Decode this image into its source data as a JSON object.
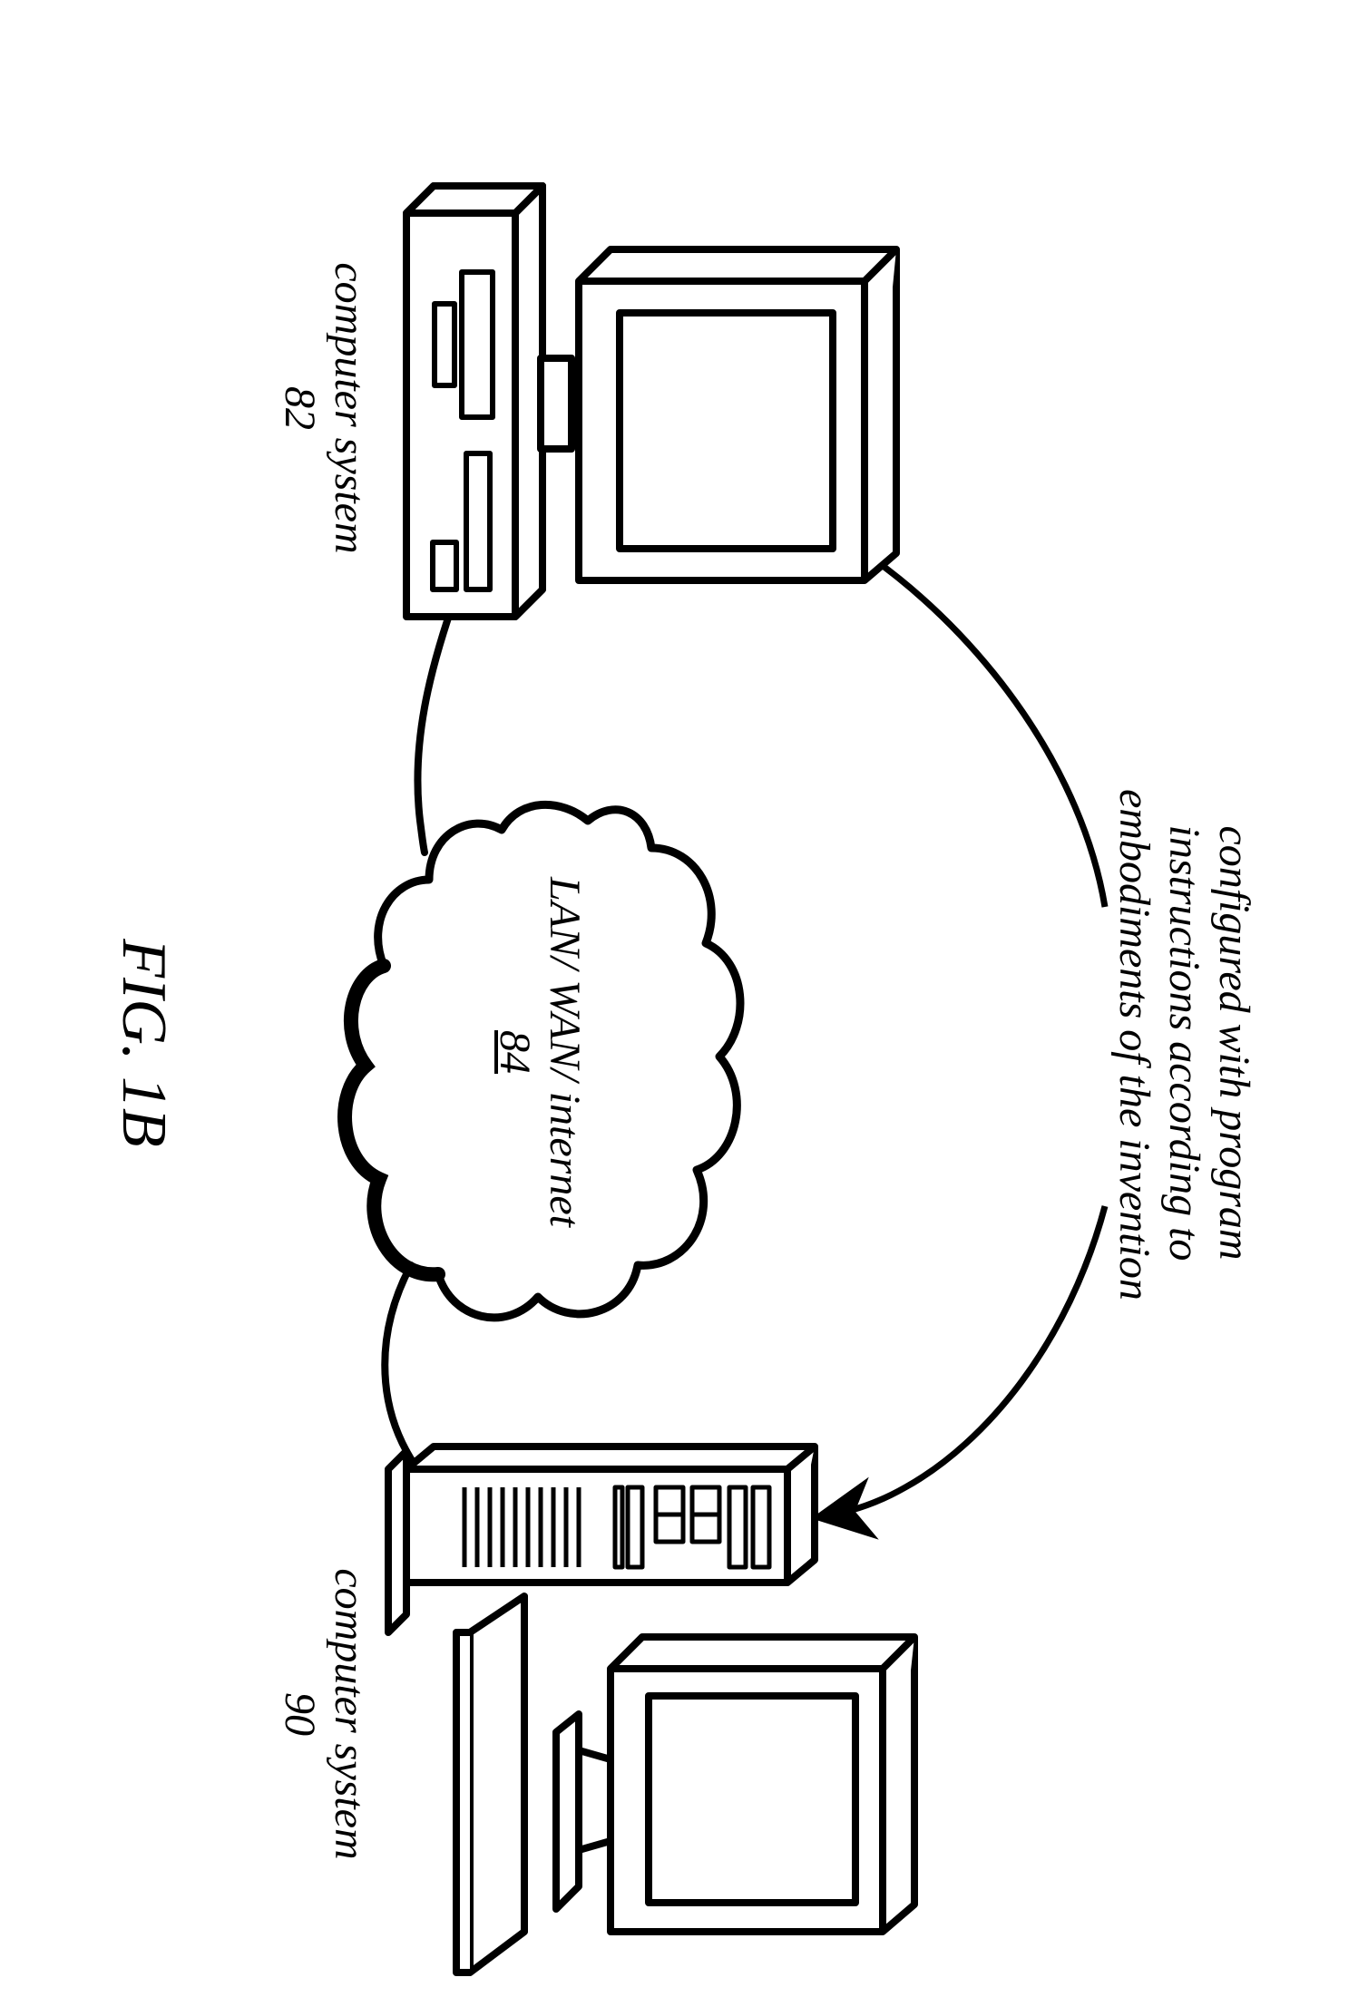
{
  "figure": {
    "caption": "FIG. 1B",
    "annotation": {
      "line1": "configured with program",
      "line2": "instructions according to",
      "line3": "embodiments of the invention"
    },
    "cloud": {
      "label": "LAN/ WAN/ internet",
      "ref": "84"
    },
    "left_computer": {
      "label": "computer system",
      "ref": "82"
    },
    "right_computer": {
      "label": "computer system",
      "ref": "90"
    }
  }
}
